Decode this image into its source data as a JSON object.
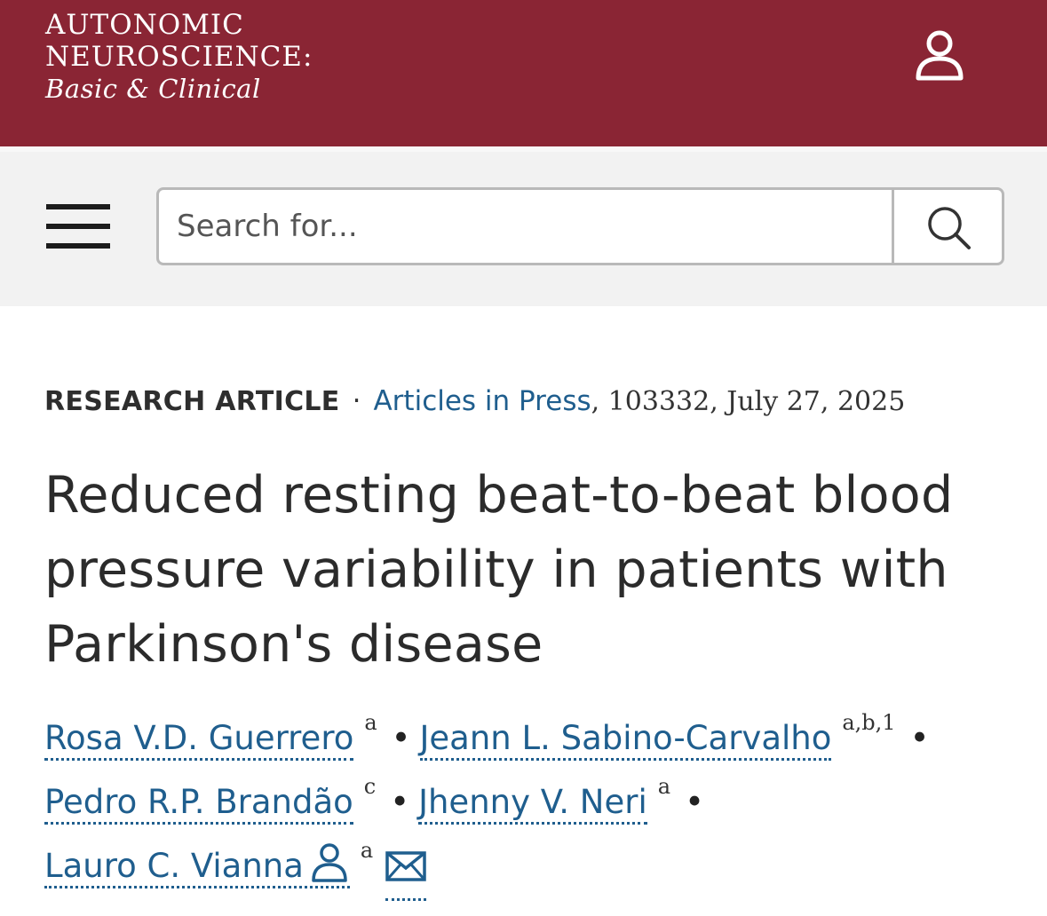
{
  "header": {
    "journal_line1": "AUTONOMIC",
    "journal_line2": "NEUROSCIENCE:",
    "journal_line3": "Basic & Clinical",
    "brand_color": "#8a2534",
    "account_icon": "person-icon"
  },
  "search": {
    "menu_icon": "hamburger-menu-icon",
    "placeholder": "Search for...",
    "search_icon": "magnifier-icon"
  },
  "article": {
    "type": "RESEARCH ARTICLE",
    "source_link": "Articles in Press",
    "details": ", 103332, July 27, 2025",
    "title": "Reduced resting beat-to-beat blood pressure variability in patients with Parkinson's disease",
    "link_color": "#1f5e8e",
    "authors": [
      {
        "name": "Rosa V.D. Guerrero",
        "aff": "a"
      },
      {
        "name": "Jeann L. Sabino-Carvalho",
        "aff": "a,b,1"
      },
      {
        "name": "Pedro R.P. Brandão",
        "aff": "c"
      },
      {
        "name": "Jhenny V. Neri",
        "aff": "a"
      },
      {
        "name": "Lauro C. Vianna",
        "aff": "a",
        "corresponding_icon": "person-icon",
        "email_icon": "envelope-icon"
      }
    ]
  }
}
